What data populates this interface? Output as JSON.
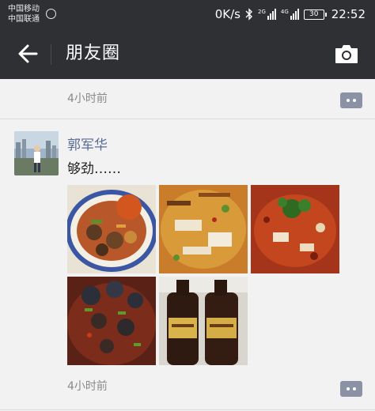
{
  "status_bar": {
    "carrier_1": "中国移动",
    "carrier_2": "中国联通",
    "speed": "0K/s",
    "net_1": "2G",
    "net_2": "4G",
    "battery": "30",
    "time": "22:52"
  },
  "app_bar": {
    "title": "朋友圈",
    "back_icon": "arrow-left-icon",
    "camera_icon": "camera-icon"
  },
  "feed": {
    "prev_post_time": "4小时前",
    "post": {
      "author": "郭军华",
      "text": "够劲……",
      "photos": [
        "crab-dish",
        "fish-soup-dish",
        "chili-fish-dish",
        "snail-dish",
        "beer-bottles"
      ],
      "time": "4小时前"
    }
  },
  "colors": {
    "bar_bg": "#2f3034",
    "page_bg": "#f2f2f2",
    "name": "#586b95",
    "comment_btn": "#8b92a5"
  }
}
